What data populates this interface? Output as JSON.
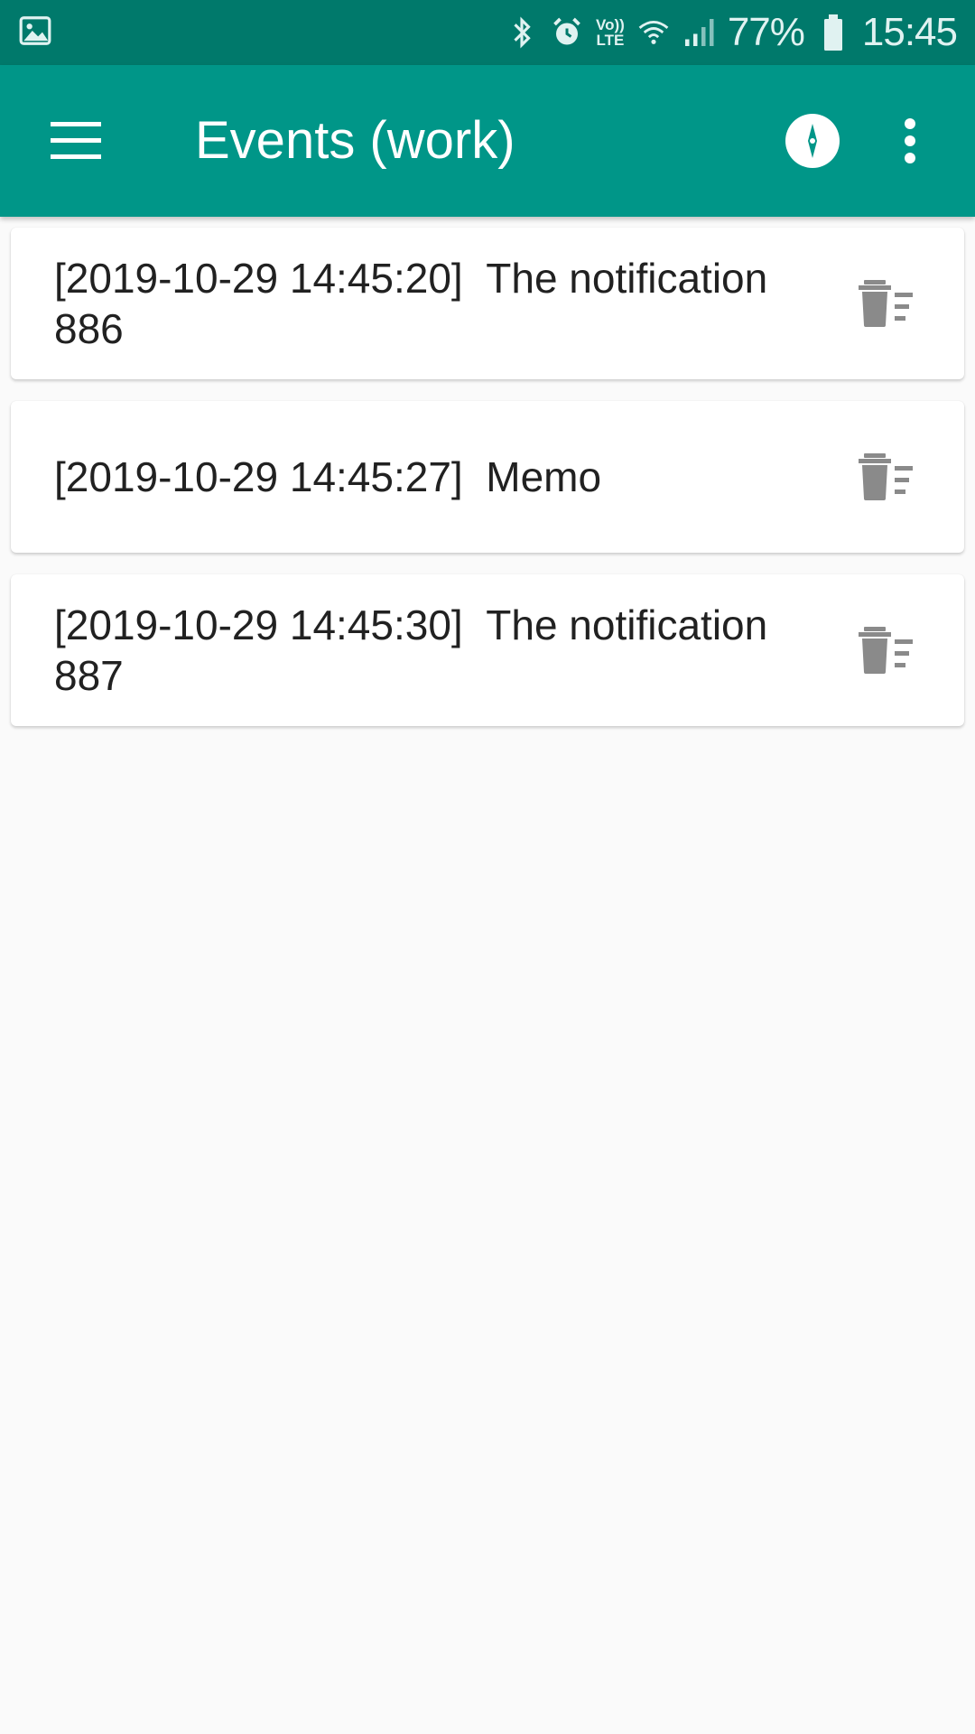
{
  "status_bar": {
    "battery": "77%",
    "time": "15:45",
    "volte_top": "Vo))",
    "volte_bottom": "LTE",
    "icons": [
      "gallery-icon",
      "bluetooth-icon",
      "alarm-icon",
      "volte-icon",
      "wifi-icon",
      "signal-icon",
      "battery-icon"
    ]
  },
  "app_bar": {
    "title": "Events (work)",
    "icons": [
      "menu-icon",
      "compass-icon",
      "more-vert-icon"
    ],
    "color": "#009688",
    "status_color": "#00796b"
  },
  "events": [
    {
      "timestamp": "[2019-10-29 14:45:20]",
      "message": "The notification 886"
    },
    {
      "timestamp": "[2019-10-29 14:45:27]",
      "message": "Memo"
    },
    {
      "timestamp": "[2019-10-29 14:45:30]",
      "message": "The notification 887"
    }
  ],
  "item_icon": "delete-sweep-icon"
}
